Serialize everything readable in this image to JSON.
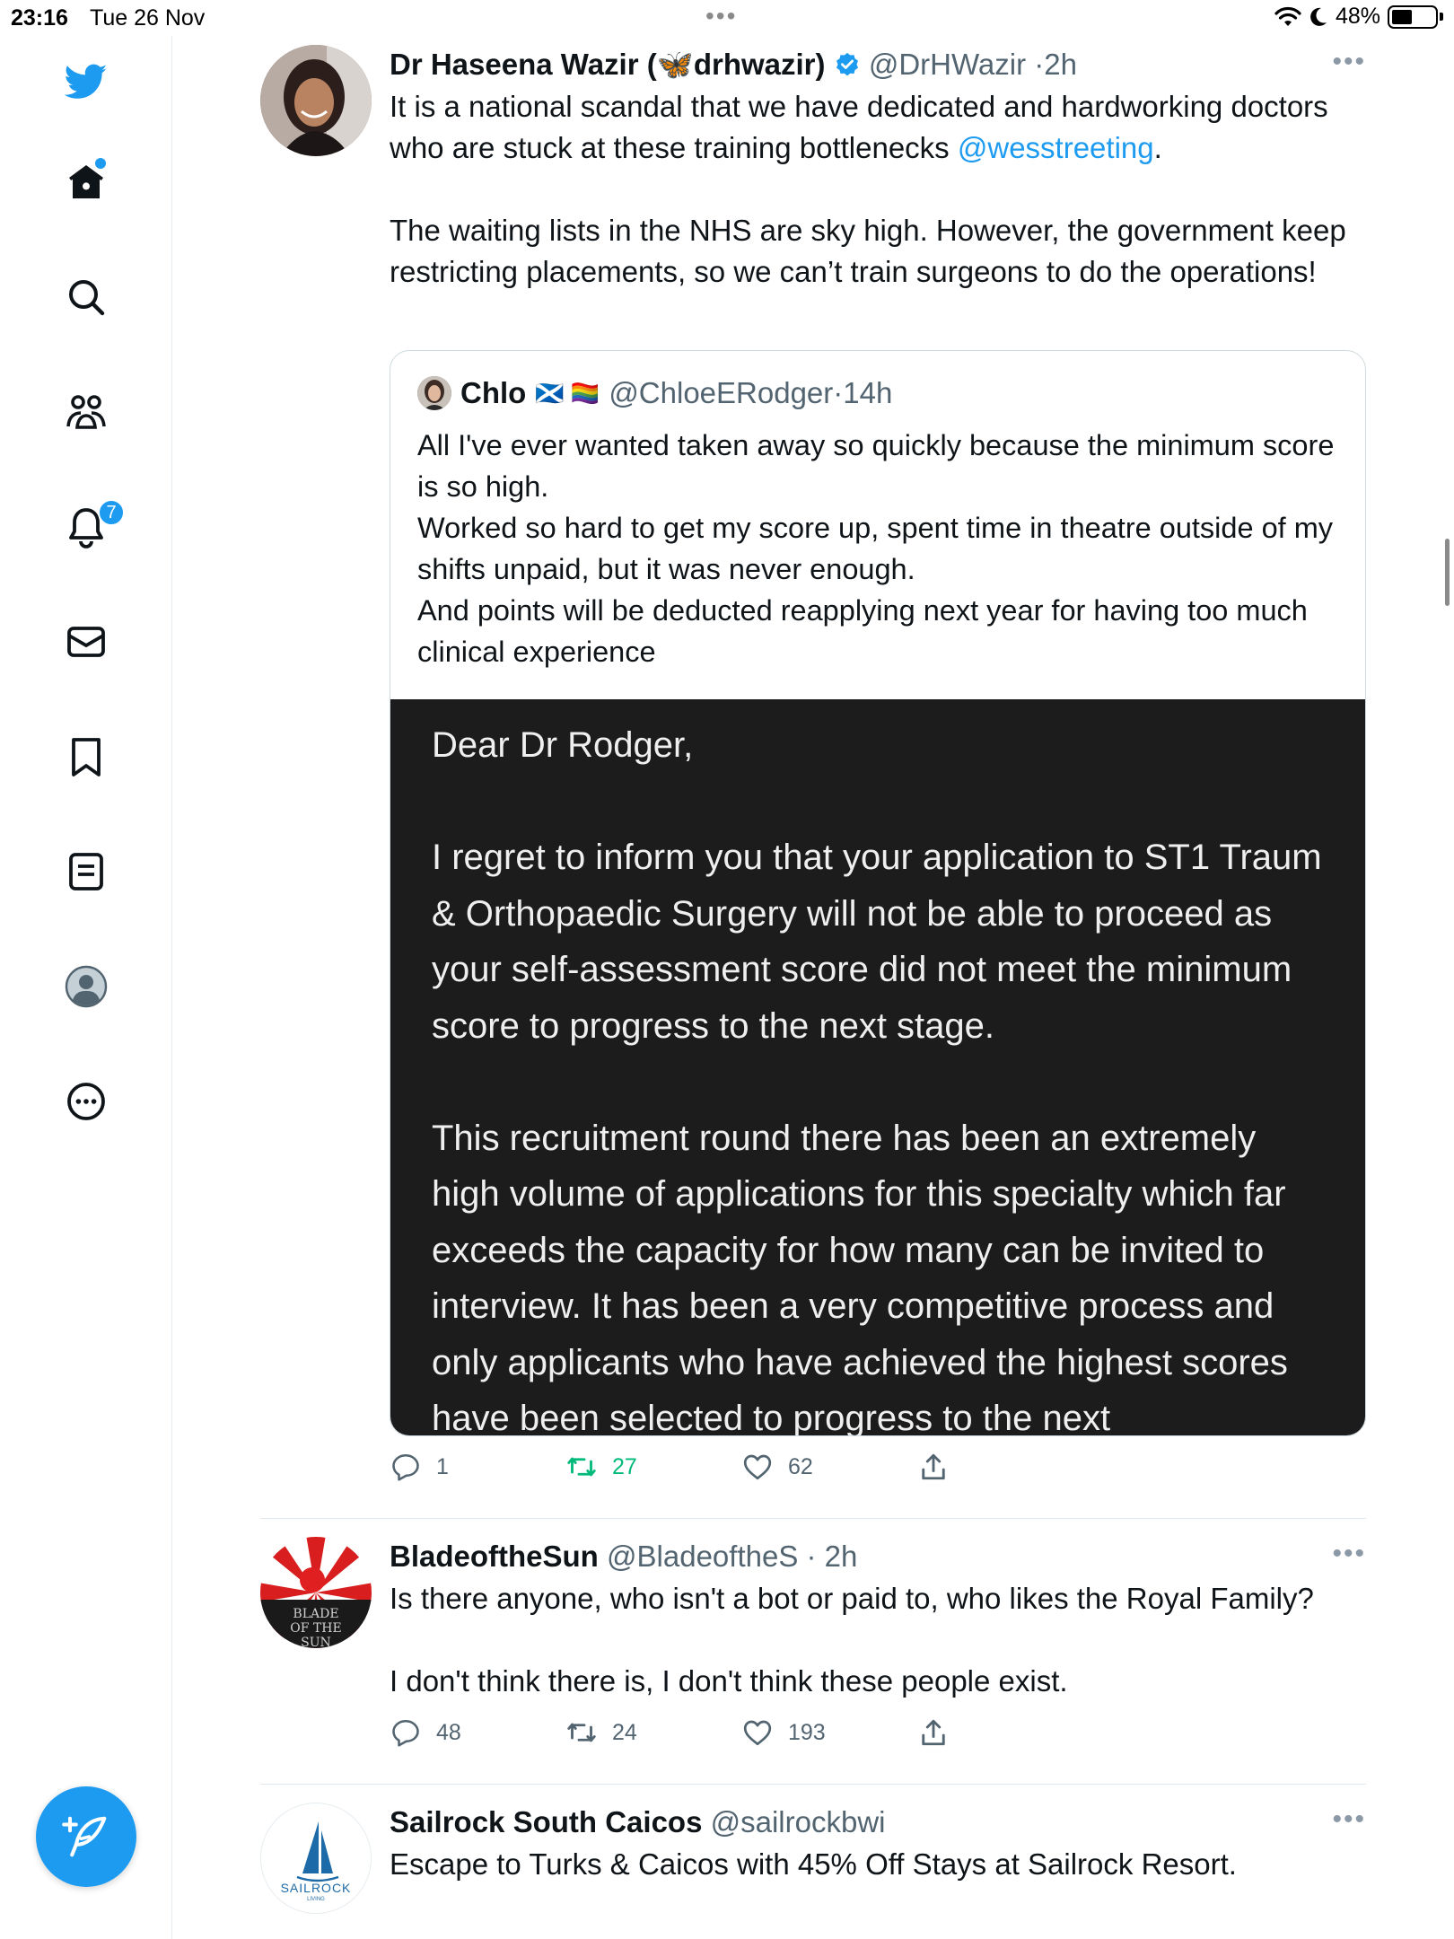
{
  "status_bar": {
    "time": "23:16",
    "date": "Tue 26 Nov",
    "battery": "48%",
    "battery_level": 0.48
  },
  "sidebar": {
    "items": [
      {
        "id": "home",
        "icon": "home-icon",
        "has_dot": true
      },
      {
        "id": "explore",
        "icon": "search-icon"
      },
      {
        "id": "communities",
        "icon": "communities-icon"
      },
      {
        "id": "notifications",
        "icon": "bell-icon",
        "badge": "7"
      },
      {
        "id": "messages",
        "icon": "envelope-icon"
      },
      {
        "id": "bookmarks",
        "icon": "bookmark-icon"
      },
      {
        "id": "lists",
        "icon": "list-icon"
      },
      {
        "id": "profile",
        "icon": "profile-avatar-icon"
      },
      {
        "id": "more",
        "icon": "more-circle-icon"
      }
    ],
    "compose_icon": "compose-feather-icon",
    "accent_color": "#1d9bf0"
  },
  "tweets": [
    {
      "name_prefix": "Dr Haseena Wazir (",
      "name_emoji": "🦋",
      "name_suffix": "drhwazir)",
      "verified": true,
      "handle": "@DrHWazir",
      "time": "2h",
      "text_parts": [
        "It is a national scandal that we have dedicated and hardworking doctors who are stuck at these training bottlenecks ",
        "@wesstreeting",
        ".\n\nThe waiting lists in the NHS are sky high. However, the government keep restricting placements, so we can’t train surgeons to do the operations!"
      ],
      "quote": {
        "name": "Chlo",
        "flags": "🏴󠁧󠁢󠁳󠁣󠁴󠁿 🏳️‍🌈",
        "handle": "@ChloeERodger",
        "time": "14h",
        "text": "All I've ever wanted taken away so quickly because the minimum score is so high.\nWorked so hard to get my score up, spent time in theatre outside of my shifts unpaid, but it was never enough.\nAnd points will be deducted reapplying next year for having too much clinical experience",
        "image_text": "Dear Dr Rodger,\n\nI regret to inform you that your application to ST1 Traum & Orthopaedic Surgery will not be able to proceed as your self-assessment score did not meet the minimum score to progress to the next stage.\n\nThis recruitment round there has been an extremely high volume of applications for this specialty which far exceeds the capacity for how many can be invited to interview. It has been a very competitive process and only applicants who have achieved the highest scores have been selected to progress to the next"
      },
      "replies": "1",
      "retweets": "27",
      "likes": "62",
      "retweeted": true
    },
    {
      "name": "BladeoftheSun",
      "handle": "@BladeoftheS",
      "time": "2h",
      "avatar_text": "BLADE OF THE SUN",
      "text": "Is there anyone, who isn't a bot or paid to, who likes the Royal Family?\n\nI don't think there is, I don't think these people exist.",
      "replies": "48",
      "retweets": "24",
      "likes": "193"
    },
    {
      "name": "Sailrock South Caicos",
      "handle": "@sailrockbwi",
      "avatar_text": "SAILROCK",
      "avatar_subtext": "LIVING",
      "text": "Escape to Turks & Caicos with 45% Off Stays at Sailrock Resort."
    }
  ]
}
